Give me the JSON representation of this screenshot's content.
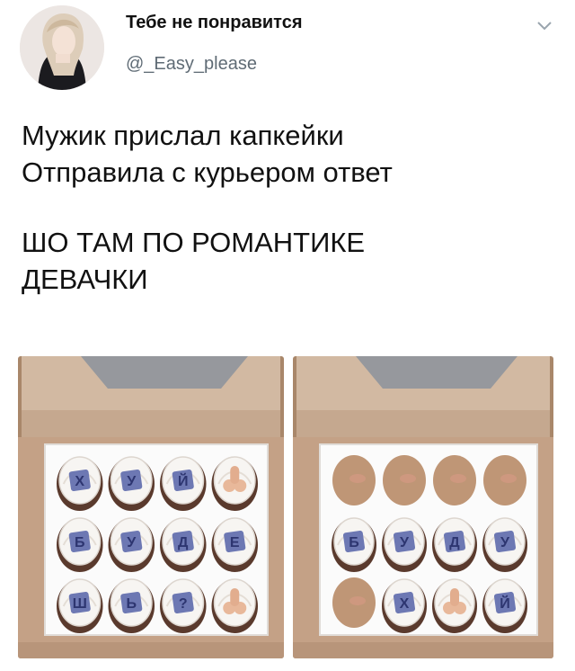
{
  "user": {
    "display_name": "Тебе не понравится",
    "handle": "@_Easy_please"
  },
  "tweet": {
    "lines": [
      "Мужик прислал капкейки",
      "Отправила с курьером ответ",
      "",
      "ШО ТАМ ПО РОМАНТИКЕ",
      "ДЕВАЧКИ"
    ]
  },
  "media": {
    "left_letters": [
      "Х",
      "У",
      "Й",
      "",
      "Б",
      "У",
      "Д",
      "Е",
      "Ш",
      "Ь",
      "?",
      ""
    ],
    "right_letters": [
      "",
      "",
      "",
      "",
      "Б",
      "У",
      "Д",
      "У",
      "",
      "Х",
      "",
      "Й"
    ]
  },
  "icons": {
    "menu": "chevron-down-icon"
  }
}
